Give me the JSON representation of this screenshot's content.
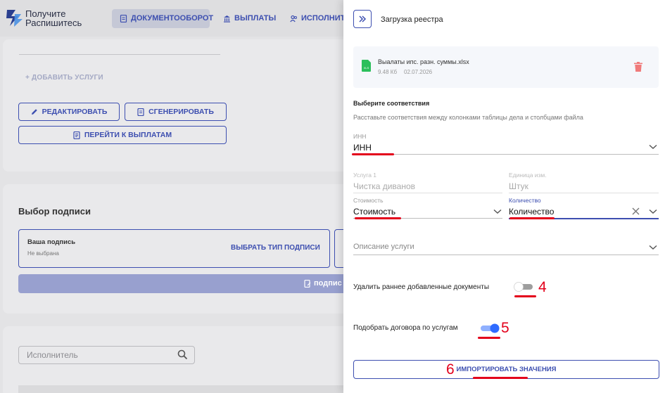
{
  "app": {
    "logo_line1": "Получите",
    "logo_line2": "Распишитесь",
    "nav": [
      {
        "label": "ДОКУМЕНТООБОРОТ",
        "icon": "document-icon",
        "active": true
      },
      {
        "label": "ВЫПЛАТЫ",
        "icon": "bank-icon",
        "active": false
      },
      {
        "label": "ИСПОЛНИТЕ",
        "icon": "users-icon",
        "active": false
      }
    ],
    "add_service": "+ ДОБАВИТЬ УСЛУГИ",
    "edit_label": "РЕДАКТИРОВАТЬ",
    "generate_label": "СГЕНЕРИРОВАТЬ",
    "goto_payments_label": "ПЕРЕЙТИ К ВЫПЛАТАМ",
    "signature_section_title": "Выбор подписи",
    "signature_card_title": "Ваша подпись",
    "signature_card_status": "Не выбрана",
    "signature_choose_label": "ВЫБРАТЬ ТИП ПОДПИСИ",
    "sign_button_label": "подпис",
    "search_placeholder": "Исполнитель"
  },
  "panel": {
    "title": "Загрузка реестра",
    "file": {
      "name": "Выалаты ипс. разн. суммы.xlsx",
      "size": "9.48 Кб",
      "date": "02.07.2026",
      "badge": "XLS"
    },
    "match_heading": "Выберите соответствия",
    "match_subheading": "Расставьте соответствия между колонками таблицы дела и столбцами файла",
    "fields": {
      "inn": {
        "label": "ИНН",
        "value": "ИНН"
      },
      "service": {
        "label": "Услуга 1",
        "value": "Чистка диванов"
      },
      "unit": {
        "label": "Единица изм.",
        "value": "Штук"
      },
      "cost": {
        "label": "Стоимость",
        "value": "Стоимость"
      },
      "quantity": {
        "label": "Количество",
        "value": "Количество"
      },
      "description": {
        "label": "",
        "value": "Описание услуги"
      }
    },
    "toggle_delete": {
      "label": "Удалить раннее добавленные документы",
      "on": false
    },
    "toggle_match": {
      "label": "Подобрать договора по услугам",
      "on": true
    },
    "import_label": "ИМПОРТИРОВАТЬ ЗНАЧЕНИЯ"
  },
  "annotations": {
    "num4": "4",
    "num5": "5",
    "num6": "6",
    "color": "#e3001b"
  },
  "colors": {
    "accent": "#3d4fb0",
    "toggle_on": "#2f6bff",
    "trash": "#f07a7a",
    "xls": "#2bbf5b"
  }
}
